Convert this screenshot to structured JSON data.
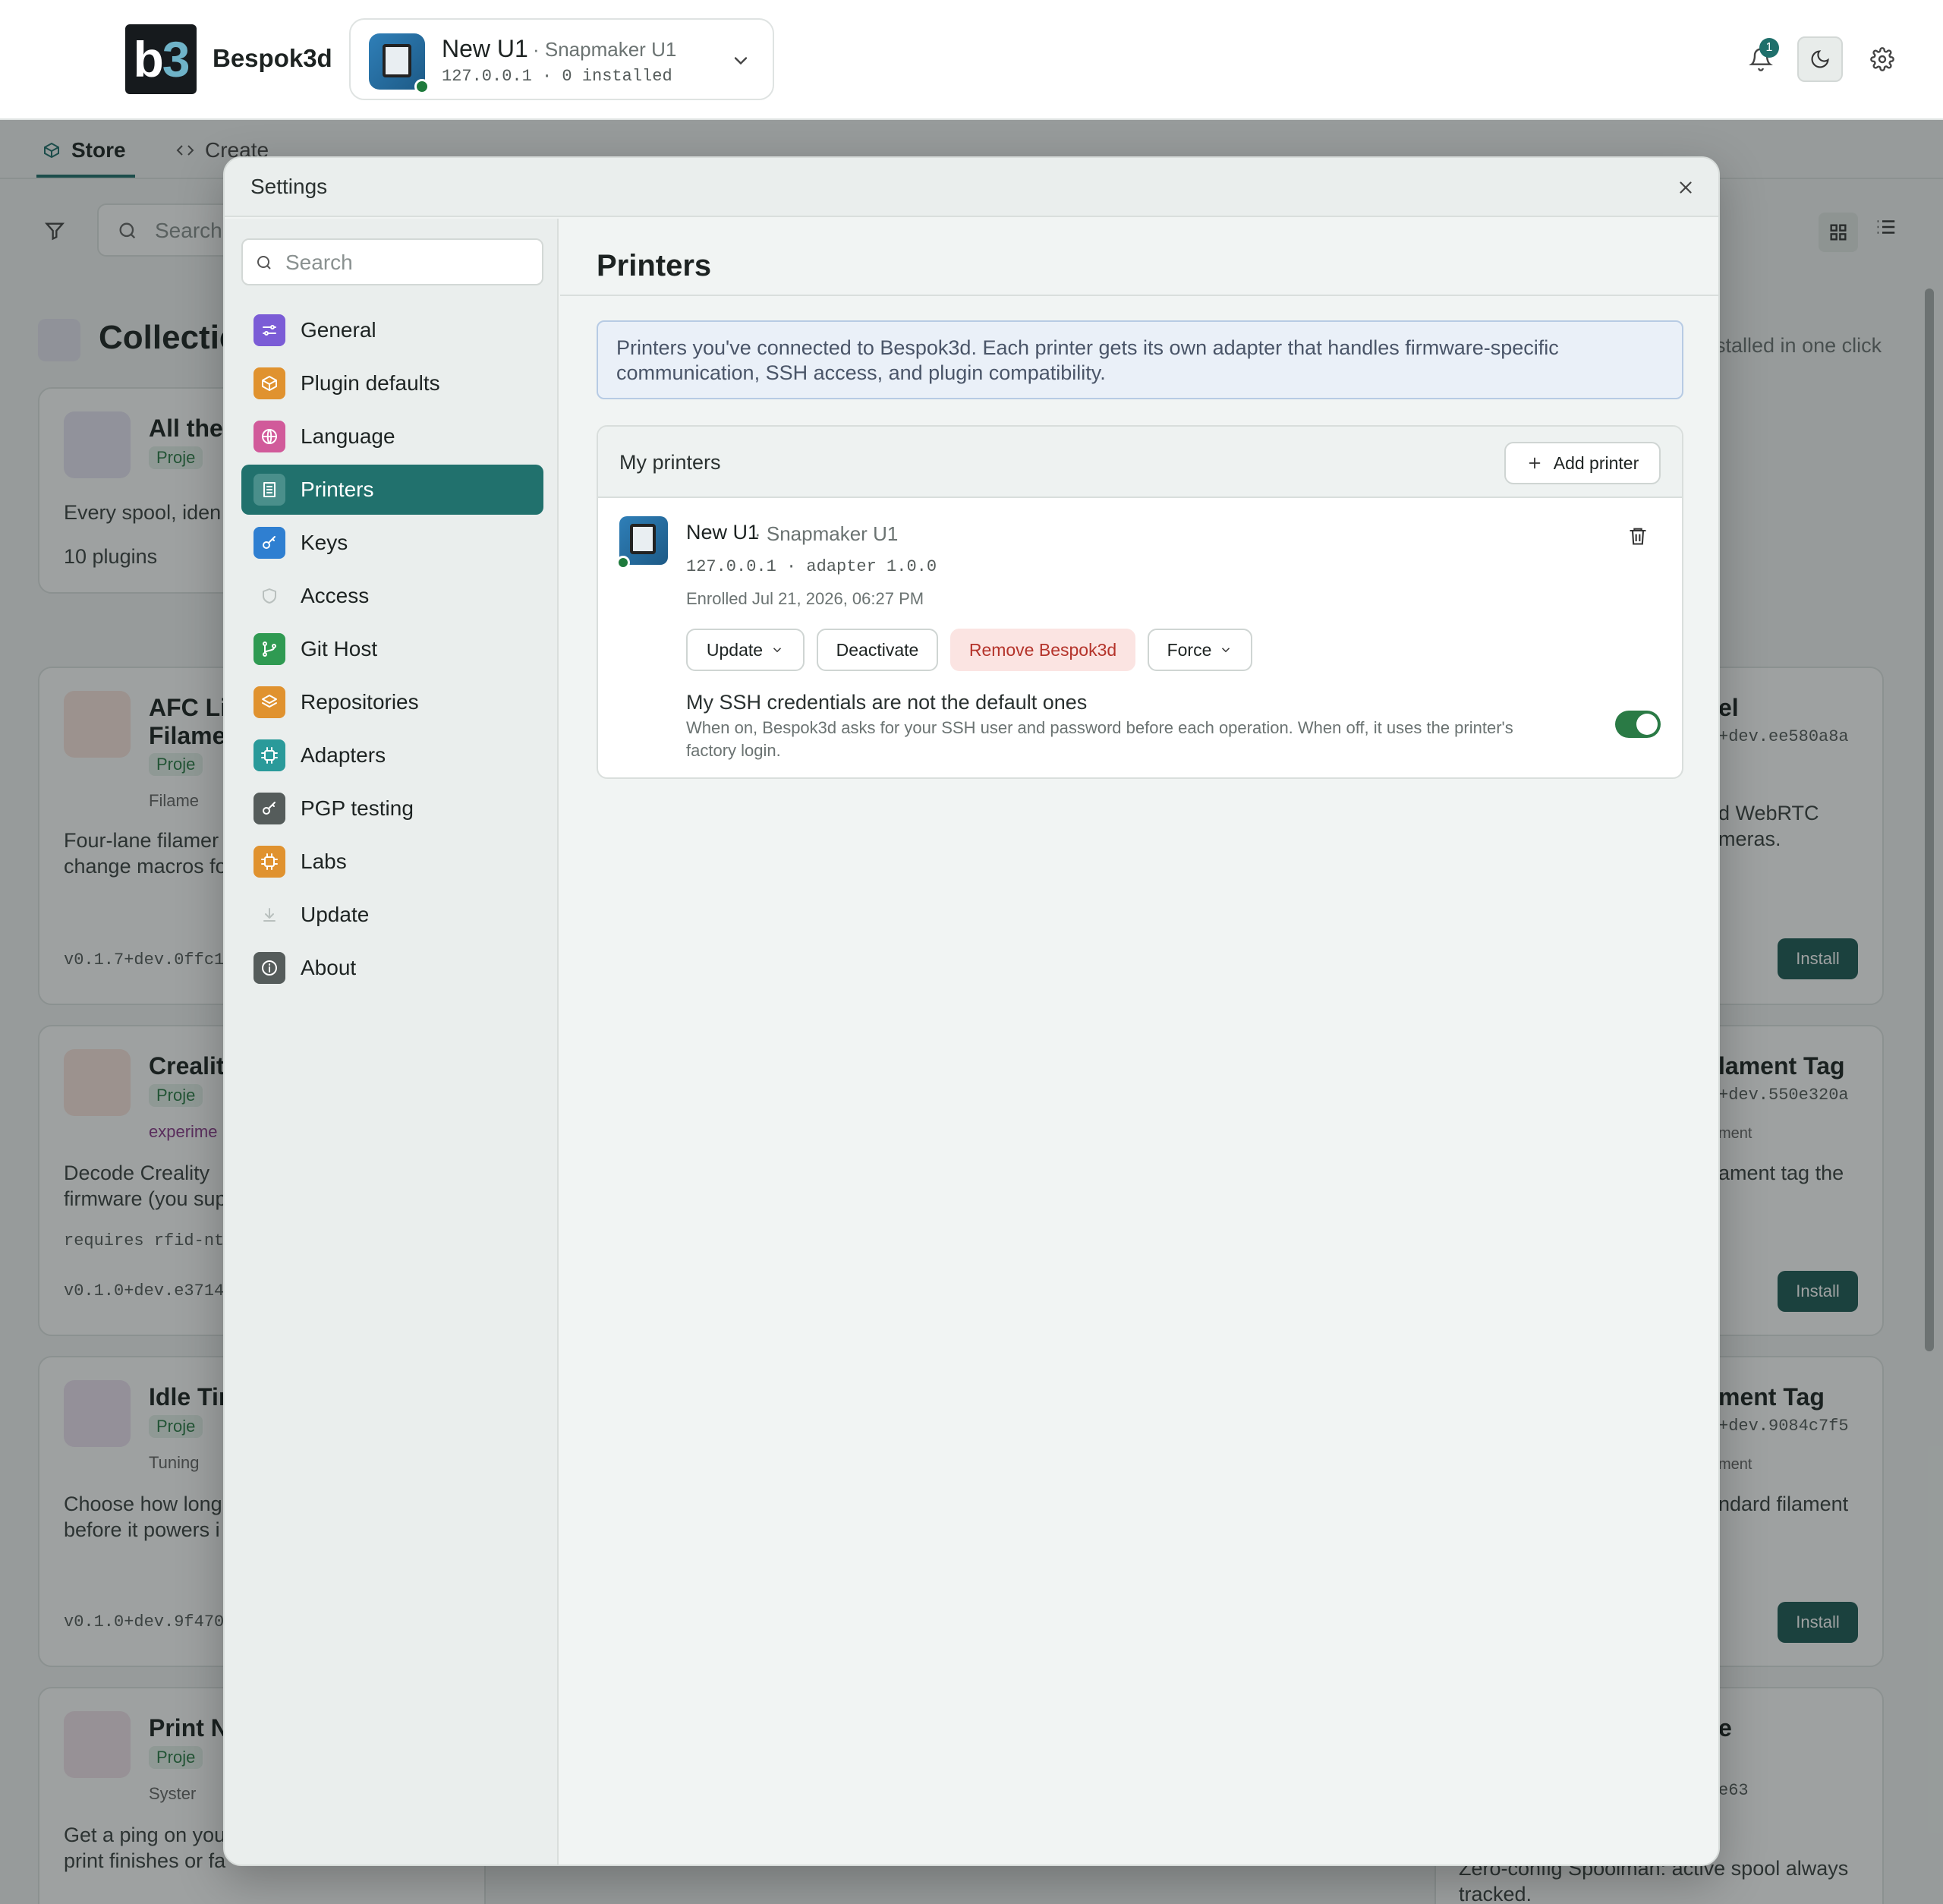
{
  "app": {
    "brand": "Bespok3d",
    "logo_text": "b3",
    "notifications_count": "1"
  },
  "printer_switcher": {
    "name": "New U1",
    "model": "· Snapmaker U1",
    "meta": "127.0.0.1 · 0 installed"
  },
  "background": {
    "tabs": [
      {
        "label": "Store"
      },
      {
        "label": "Create"
      }
    ],
    "search_placeholder": "Search",
    "collection_title": "Collectic",
    "collection_subtitle": "stalled in one click",
    "cards": [
      {
        "title": "All the T",
        "pill": "Proje",
        "text": "Every spool, iden",
        "count": "10 plugins"
      },
      {
        "title": "AFC Lit Filamer",
        "pill": "Proje",
        "tag": "Filame",
        "text": "Four-lane filamer change macros fo",
        "version": "v0.1.7+dev.0ffc1"
      },
      {
        "title": "Creality",
        "pill": "Proje",
        "tag": "experime",
        "text": "Decode Creality firmware (you sup",
        "requires": "requires rfid-nt",
        "version": "v0.1.0+dev.e3714"
      },
      {
        "title": "Idle Tim",
        "pill": "Proje",
        "tag": "Tuning",
        "text": "Choose how long before it powers i",
        "version": "v0.1.0+dev.9f470"
      },
      {
        "title": "Print No",
        "pill": "Proje",
        "tag": "Syster",
        "text": "Get a ping on you print finishes or fa"
      }
    ],
    "right_cards": [
      {
        "title": "el",
        "version": "+dev.ee580a8a",
        "text": "d WebRTC meras.",
        "install": "Install"
      },
      {
        "title": "lament Tag",
        "version": "+dev.550e320a",
        "tag": "ment",
        "text": "ament tag the",
        "install": "Install"
      },
      {
        "title": "ment Tag",
        "version": "+dev.9084c7f5",
        "tag": "ment",
        "text": "ndard filament",
        "install": "Install"
      },
      {
        "title": "e",
        "version": "e63",
        "text": "Zero-config Spoolman: active spool always tracked."
      }
    ]
  },
  "settings": {
    "title": "Settings",
    "search_placeholder": "Search",
    "nav": [
      {
        "label": "General",
        "icon": "sliders-icon",
        "color": "#7b5cd6"
      },
      {
        "label": "Plugin defaults",
        "icon": "package-icon",
        "color": "#e0922f"
      },
      {
        "label": "Language",
        "icon": "globe-icon",
        "color": "#d15a9a"
      },
      {
        "label": "Printers",
        "icon": "printer-icon",
        "color": "#4a8f8b"
      },
      {
        "label": "Keys",
        "icon": "key-icon",
        "color": "#2f7fd1"
      },
      {
        "label": "Access",
        "icon": "shield-icon",
        "color": "#c9cfcd"
      },
      {
        "label": "Git Host",
        "icon": "git-branch-icon",
        "color": "#2f9a52"
      },
      {
        "label": "Repositories",
        "icon": "layers-icon",
        "color": "#e0922f"
      },
      {
        "label": "Adapters",
        "icon": "cpu-icon",
        "color": "#2a9a9a"
      },
      {
        "label": "PGP testing",
        "icon": "key-icon",
        "color": "#555c5b"
      },
      {
        "label": "Labs",
        "icon": "cpu-icon",
        "color": "#e0922f"
      },
      {
        "label": "Update",
        "icon": "download-icon",
        "color": "#c9cfcd"
      },
      {
        "label": "About",
        "icon": "info-icon",
        "color": "#555c5b"
      }
    ],
    "active_nav": "Printers",
    "page_title": "Printers",
    "info_text": "Printers you've connected to Bespok3d. Each printer gets its own adapter that handles firmware-specific communication, SSH access, and plugin compatibility.",
    "panel_title": "My printers",
    "add_printer_label": "Add printer",
    "printer": {
      "name": "New U1",
      "model": "· Snapmaker U1",
      "meta": "127.0.0.1 · adapter 1.0.0",
      "enrolled": "Enrolled Jul 21, 2026, 06:27 PM",
      "buttons": {
        "update": "Update",
        "deactivate": "Deactivate",
        "remove": "Remove Bespok3d",
        "force": "Force"
      },
      "ssh_title": "My SSH credentials are not the default ones",
      "ssh_desc": "When on, Bespok3d asks for your SSH user and password before each operation. When off, it uses the printer's factory login.",
      "ssh_toggle_on": true
    }
  },
  "colors": {
    "accent": "#21716d",
    "success": "#2a7a45",
    "danger": "#b4332a"
  }
}
